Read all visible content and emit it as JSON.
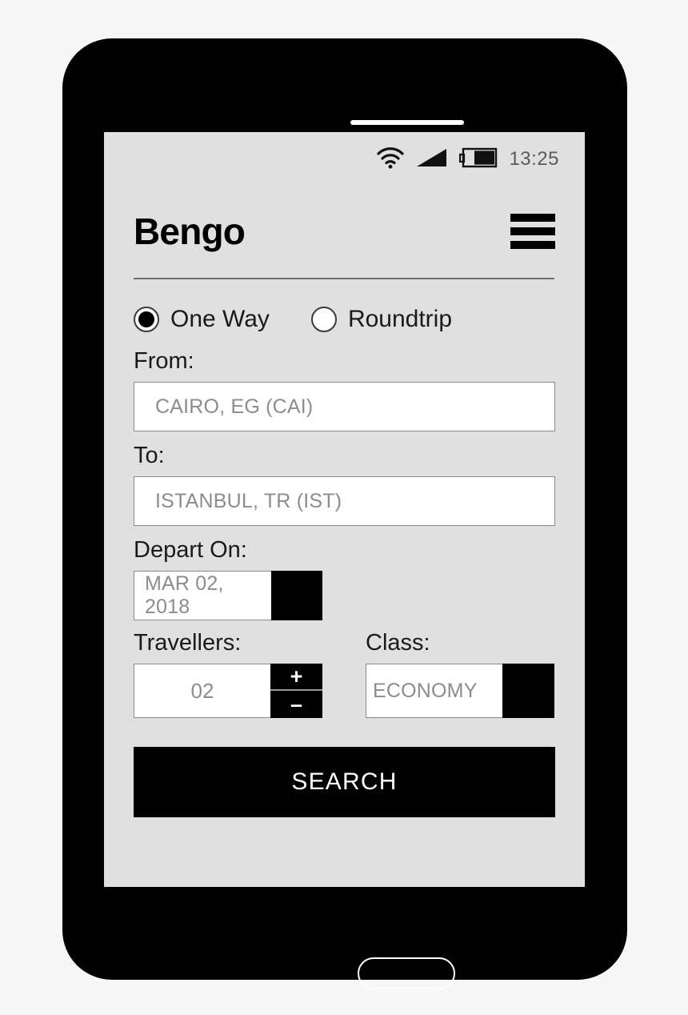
{
  "device": {
    "speaker_name": "speaker-grille",
    "home_button_name": "home-button"
  },
  "status_bar": {
    "wifi_icon": "wifi-icon",
    "signal_icon": "cellular-signal-icon",
    "battery_icon": "battery-icon",
    "time": "13:25"
  },
  "header": {
    "brand": "Bengo",
    "menu_icon": "hamburger-menu-icon"
  },
  "form": {
    "trip_type": {
      "selected": "One Way",
      "options": [
        {
          "label": "One Way",
          "selected": true
        },
        {
          "label": "Roundtrip",
          "selected": false
        }
      ]
    },
    "from": {
      "label": "From:",
      "value": "CAIRO, EG (CAI)",
      "placeholder": "CAIRO, EG (CAI)"
    },
    "to": {
      "label": "To:",
      "value": "ISTANBUL, TR (IST)",
      "placeholder": "ISTANBUL, TR (IST)"
    },
    "depart": {
      "label": "Depart On:",
      "value": "MAR 02, 2018",
      "placeholder": "MAR 02, 2018",
      "picker_icon": "calendar-picker-button"
    },
    "travellers": {
      "label": "Travellers:",
      "value": "02",
      "increment_label": "+",
      "decrement_label": "–"
    },
    "travel_class": {
      "label": "Class:",
      "value": "ECONOMY",
      "placeholder": "ECONOMY",
      "options": [
        "ECONOMY"
      ],
      "dropdown_icon": "class-dropdown-button"
    },
    "search_label": "SEARCH"
  },
  "colors": {
    "page_background": "#f7f7f7",
    "phone_body": "#000000",
    "screen_background": "#e0e0e0",
    "field_background": "#ffffff",
    "field_border": "#8a8a8a",
    "accent": "#000000",
    "placeholder_text": "#8c8c8c",
    "label_text": "#1a1a1a",
    "status_text": "#5a5a5a"
  }
}
